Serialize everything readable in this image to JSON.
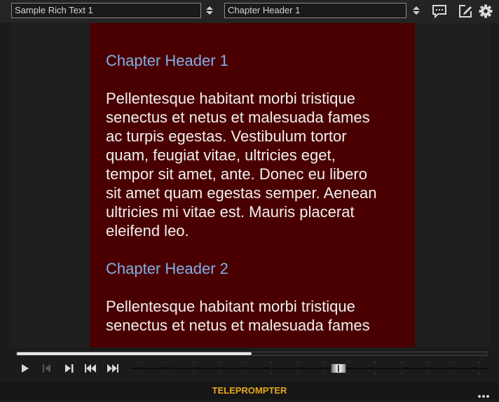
{
  "toolbar": {
    "text_select": {
      "value": "Sample Rich Text 1",
      "icon": "updown-stepper-icon"
    },
    "chapter_select": {
      "value": "Chapter Header 1",
      "icon": "updown-stepper-icon"
    },
    "icons": [
      "comment-icon",
      "edit-icon",
      "gear-icon"
    ]
  },
  "document": {
    "background_color": "#4a0000",
    "header_color": "#7fb0e6",
    "text_color": "#f0f0f0",
    "chapters": [
      {
        "header": "Chapter Header 1",
        "body_lines": [
          "Pellentesque habitant morbi tristique",
          "senectus et netus et malesuada fames",
          "ac turpis egestas. Vestibulum tortor",
          "quam, feugiat vitae, ultricies eget,",
          "tempor sit amet, ante. Donec eu libero",
          "sit amet quam egestas semper. Aenean",
          "ultricies mi vitae est. Mauris placerat",
          "eleifend leo."
        ]
      },
      {
        "header": "Chapter Header 2",
        "body_lines": [
          "Pellentesque habitant morbi tristique",
          "senectus et netus et malesuada fames"
        ]
      }
    ]
  },
  "transport": {
    "progress_fraction": 0.5,
    "speed_fraction": 0.58,
    "controls": [
      "play-icon",
      "previous-stop-icon",
      "next-icon",
      "skip-back-icon",
      "skip-forward-icon"
    ]
  },
  "footer": {
    "title": "TELEPROMPTER",
    "title_color": "#e7a51d",
    "more_icon": "more-dots-icon"
  }
}
